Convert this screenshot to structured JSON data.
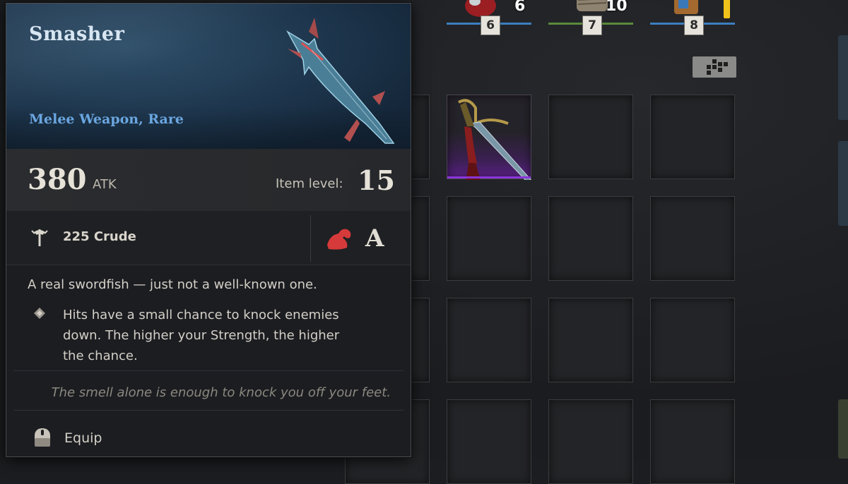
{
  "tooltip": {
    "title": "Smasher",
    "subtitle": "Melee Weapon, Rare",
    "attack_value": "380",
    "attack_label": "ATK",
    "item_level_label": "Item level:",
    "item_level_value": "15",
    "requirement_text": "225 Crude",
    "scaling_grade": "A",
    "description": "A real swordfish — just not a well-known one.",
    "perk_text": "Hits have a small chance to knock enemies down. The higher your Strength, the higher the chance.",
    "flavor_text": "The smell alone is enough to knock you off your feet.",
    "action_label": "Equip"
  },
  "inventory": {
    "top_slots": [
      {
        "badge": "6",
        "count": "6",
        "bar_color": "#3c7fc0"
      },
      {
        "badge": "7",
        "count": "10",
        "bar_color": "#5a8a3a"
      },
      {
        "badge": "8",
        "count": "",
        "bar_color": "#3c7fc0"
      }
    ],
    "equipped_item_icon": "saber-icon",
    "rarity_color": "#8a35d8"
  },
  "colors": {
    "header_blue": "#1f3850",
    "subtitle_blue": "#6aa6e0",
    "text": "#d4d0c8"
  }
}
